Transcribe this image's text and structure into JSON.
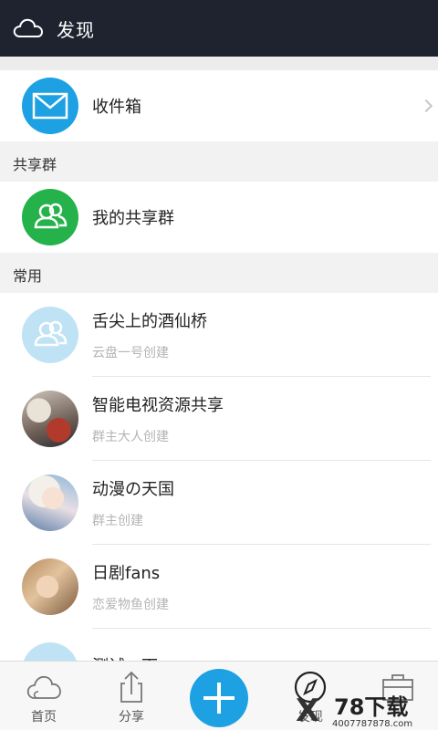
{
  "header": {
    "title": "发现"
  },
  "inbox": {
    "label": "收件箱"
  },
  "shared_section": {
    "title": "共享群"
  },
  "my_groups": {
    "label": "我的共享群"
  },
  "common_section": {
    "title": "常用"
  },
  "groups": [
    {
      "name": "舌尖上的酒仙桥",
      "creator": "云盘一号创建"
    },
    {
      "name": "智能电视资源共享",
      "creator": "群主大人创建"
    },
    {
      "name": "动漫の天国",
      "creator": "群主创建"
    },
    {
      "name": "日剧fans",
      "creator": "恋爱物鱼创建"
    },
    {
      "name": "测试一下",
      "creator": ""
    }
  ],
  "nav": [
    {
      "label": "首页",
      "icon": "cloud-icon"
    },
    {
      "label": "分享",
      "icon": "share-icon"
    },
    {
      "label": "",
      "icon": "plus-icon"
    },
    {
      "label": "发现",
      "icon": "compass-icon"
    },
    {
      "label": "",
      "icon": "briefcase-icon"
    }
  ],
  "watermark": {
    "brand": "78下载",
    "url": "4007787878.com"
  },
  "colors": {
    "header_bg": "#1f2330",
    "accent": "#1da1e2",
    "green": "#25b24a"
  }
}
